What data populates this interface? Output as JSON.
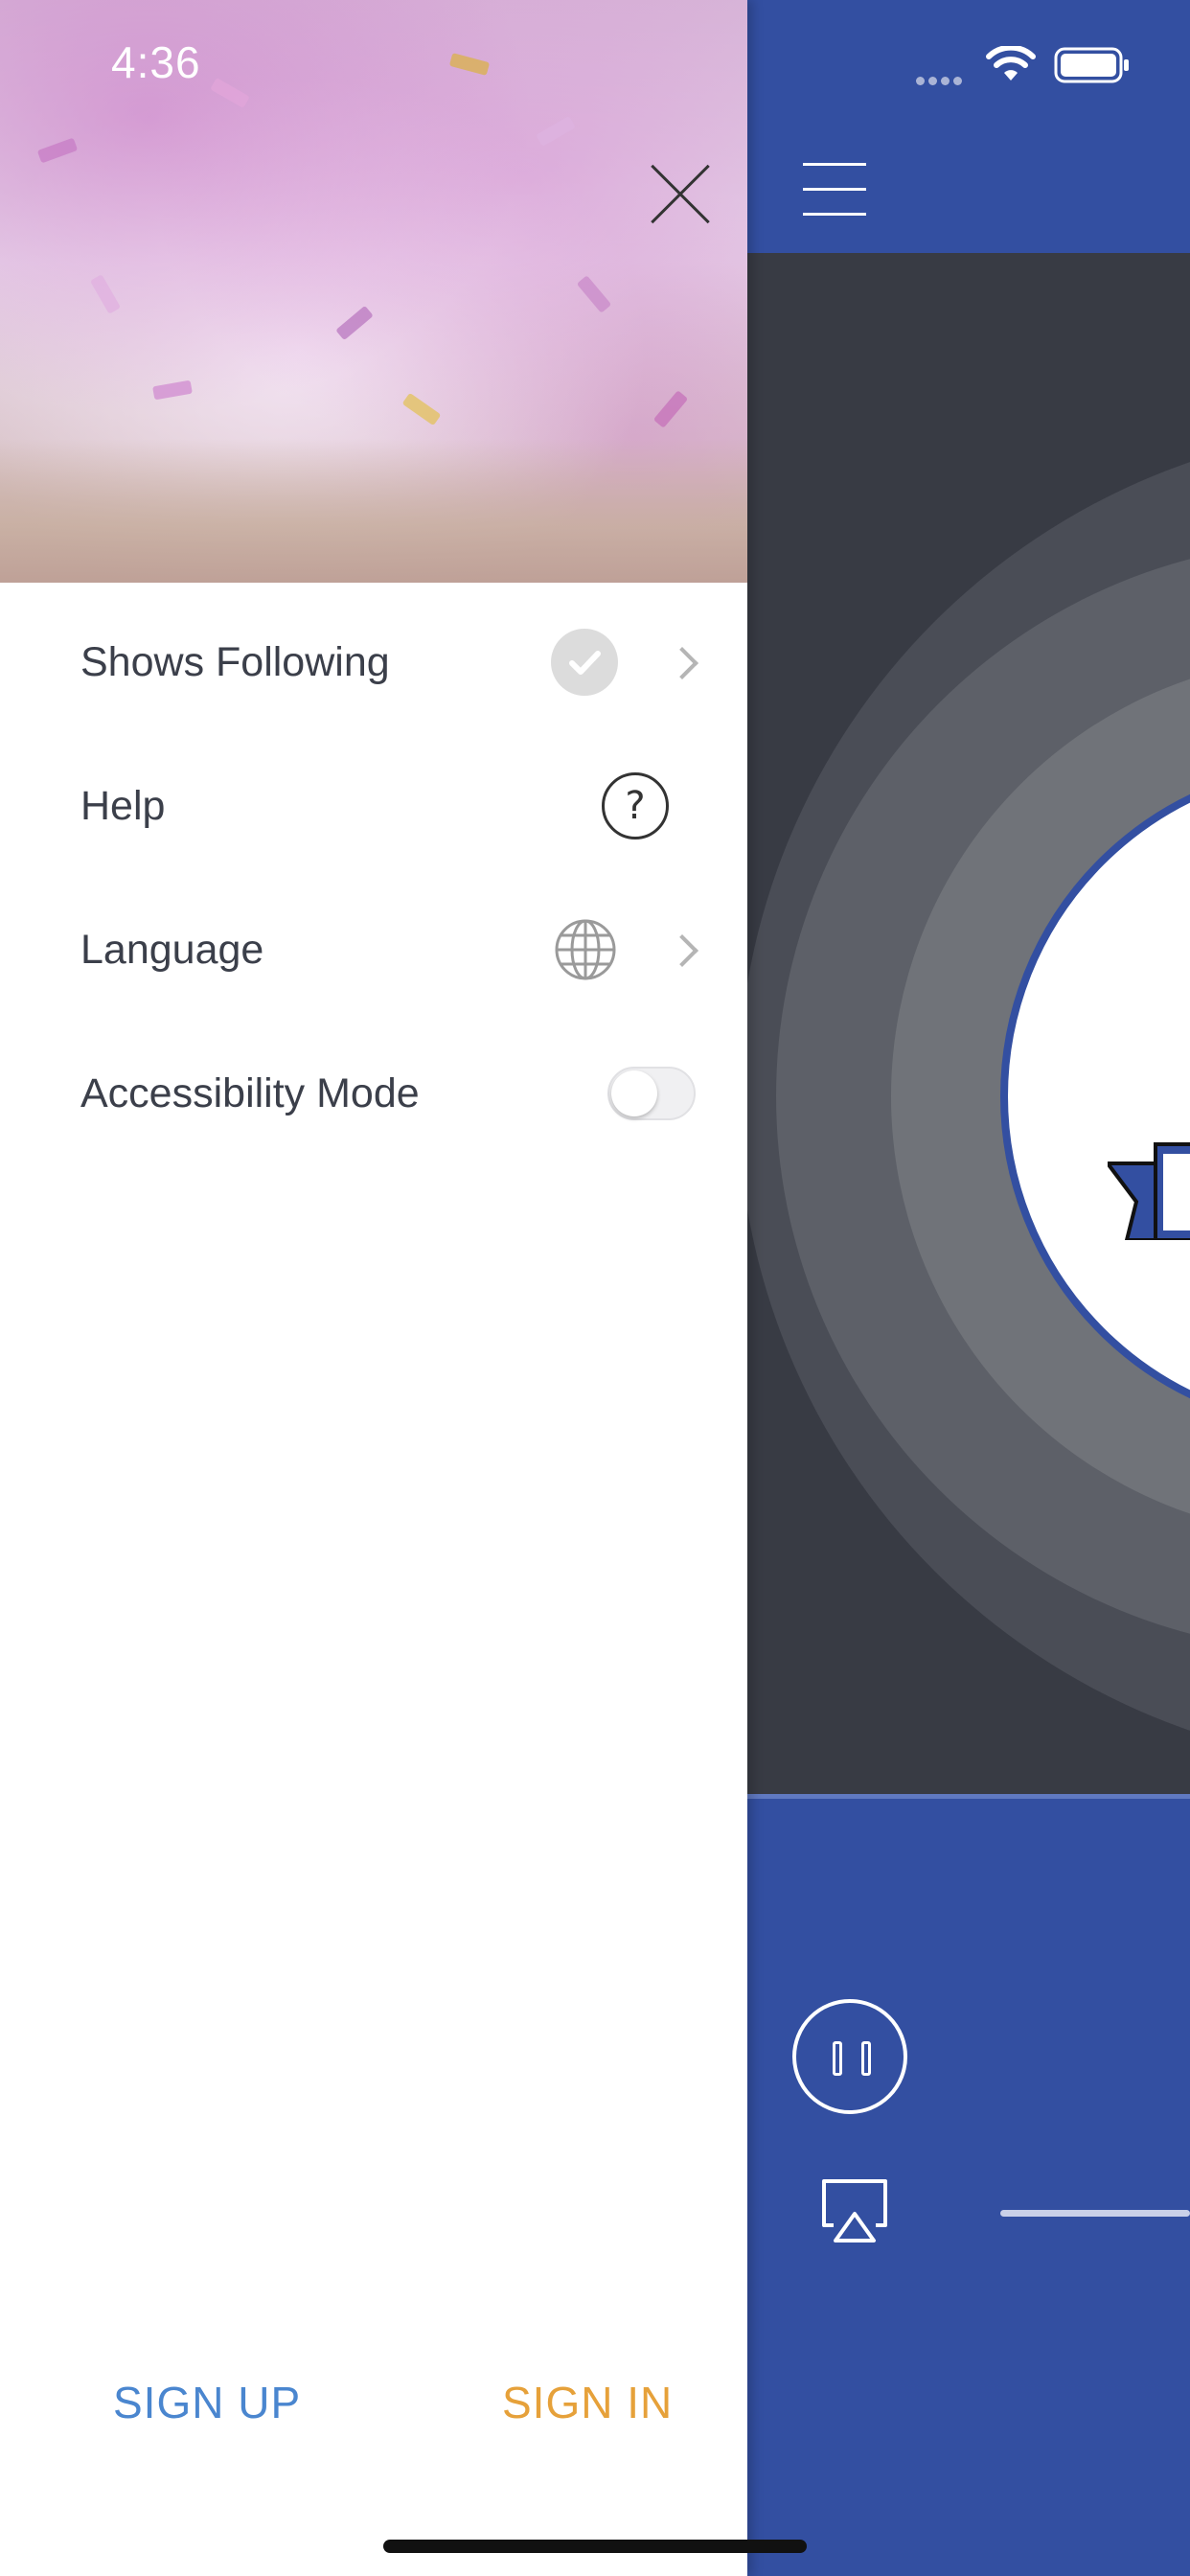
{
  "status_bar": {
    "time": "4:36"
  },
  "drawer": {
    "menu": [
      {
        "label": "Shows Following",
        "icon": "check-circle-icon",
        "has_chevron": true
      },
      {
        "label": "Help",
        "icon": "question-circle-icon",
        "has_chevron": false
      },
      {
        "label": "Language",
        "icon": "globe-icon",
        "has_chevron": true
      },
      {
        "label": "Accessibility Mode",
        "icon": "toggle",
        "toggle_on": false
      }
    ],
    "sign_up_label": "SIGN UP",
    "sign_in_label": "SIGN IN"
  },
  "colors": {
    "brand_blue": "#334fa1",
    "sign_up": "#4a86cf",
    "sign_in": "#e6a13a",
    "artwork_bg": "#383b44"
  },
  "player": {
    "state": "playing",
    "pause_icon": "pause-icon",
    "airplay_icon": "airplay-icon"
  }
}
